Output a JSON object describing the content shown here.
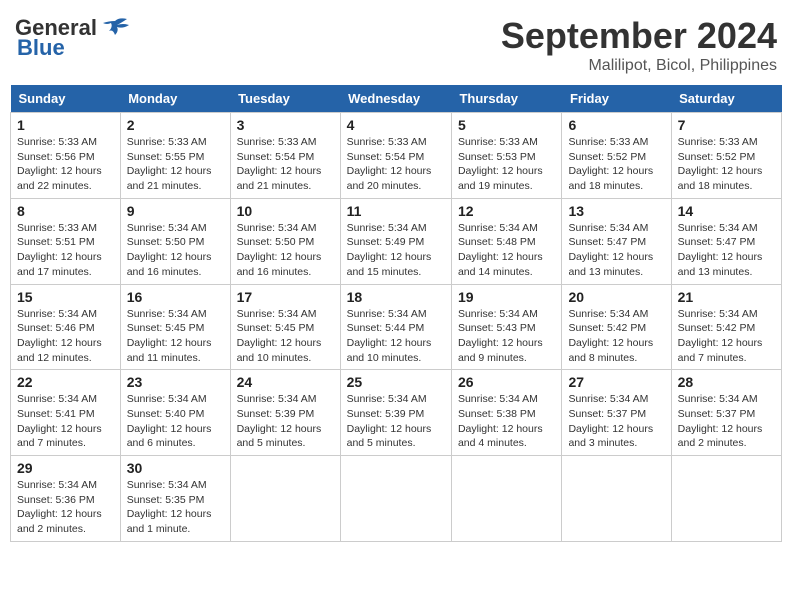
{
  "header": {
    "logo_line1": "General",
    "logo_line2": "Blue",
    "month": "September 2024",
    "location": "Malilipot, Bicol, Philippines"
  },
  "weekdays": [
    "Sunday",
    "Monday",
    "Tuesday",
    "Wednesday",
    "Thursday",
    "Friday",
    "Saturday"
  ],
  "weeks": [
    [
      {
        "day": "1",
        "sunrise": "5:33 AM",
        "sunset": "5:56 PM",
        "daylight": "12 hours and 22 minutes."
      },
      {
        "day": "2",
        "sunrise": "5:33 AM",
        "sunset": "5:55 PM",
        "daylight": "12 hours and 21 minutes."
      },
      {
        "day": "3",
        "sunrise": "5:33 AM",
        "sunset": "5:54 PM",
        "daylight": "12 hours and 21 minutes."
      },
      {
        "day": "4",
        "sunrise": "5:33 AM",
        "sunset": "5:54 PM",
        "daylight": "12 hours and 20 minutes."
      },
      {
        "day": "5",
        "sunrise": "5:33 AM",
        "sunset": "5:53 PM",
        "daylight": "12 hours and 19 minutes."
      },
      {
        "day": "6",
        "sunrise": "5:33 AM",
        "sunset": "5:52 PM",
        "daylight": "12 hours and 18 minutes."
      },
      {
        "day": "7",
        "sunrise": "5:33 AM",
        "sunset": "5:52 PM",
        "daylight": "12 hours and 18 minutes."
      }
    ],
    [
      {
        "day": "8",
        "sunrise": "5:33 AM",
        "sunset": "5:51 PM",
        "daylight": "12 hours and 17 minutes."
      },
      {
        "day": "9",
        "sunrise": "5:34 AM",
        "sunset": "5:50 PM",
        "daylight": "12 hours and 16 minutes."
      },
      {
        "day": "10",
        "sunrise": "5:34 AM",
        "sunset": "5:50 PM",
        "daylight": "12 hours and 16 minutes."
      },
      {
        "day": "11",
        "sunrise": "5:34 AM",
        "sunset": "5:49 PM",
        "daylight": "12 hours and 15 minutes."
      },
      {
        "day": "12",
        "sunrise": "5:34 AM",
        "sunset": "5:48 PM",
        "daylight": "12 hours and 14 minutes."
      },
      {
        "day": "13",
        "sunrise": "5:34 AM",
        "sunset": "5:47 PM",
        "daylight": "12 hours and 13 minutes."
      },
      {
        "day": "14",
        "sunrise": "5:34 AM",
        "sunset": "5:47 PM",
        "daylight": "12 hours and 13 minutes."
      }
    ],
    [
      {
        "day": "15",
        "sunrise": "5:34 AM",
        "sunset": "5:46 PM",
        "daylight": "12 hours and 12 minutes."
      },
      {
        "day": "16",
        "sunrise": "5:34 AM",
        "sunset": "5:45 PM",
        "daylight": "12 hours and 11 minutes."
      },
      {
        "day": "17",
        "sunrise": "5:34 AM",
        "sunset": "5:45 PM",
        "daylight": "12 hours and 10 minutes."
      },
      {
        "day": "18",
        "sunrise": "5:34 AM",
        "sunset": "5:44 PM",
        "daylight": "12 hours and 10 minutes."
      },
      {
        "day": "19",
        "sunrise": "5:34 AM",
        "sunset": "5:43 PM",
        "daylight": "12 hours and 9 minutes."
      },
      {
        "day": "20",
        "sunrise": "5:34 AM",
        "sunset": "5:42 PM",
        "daylight": "12 hours and 8 minutes."
      },
      {
        "day": "21",
        "sunrise": "5:34 AM",
        "sunset": "5:42 PM",
        "daylight": "12 hours and 7 minutes."
      }
    ],
    [
      {
        "day": "22",
        "sunrise": "5:34 AM",
        "sunset": "5:41 PM",
        "daylight": "12 hours and 7 minutes."
      },
      {
        "day": "23",
        "sunrise": "5:34 AM",
        "sunset": "5:40 PM",
        "daylight": "12 hours and 6 minutes."
      },
      {
        "day": "24",
        "sunrise": "5:34 AM",
        "sunset": "5:39 PM",
        "daylight": "12 hours and 5 minutes."
      },
      {
        "day": "25",
        "sunrise": "5:34 AM",
        "sunset": "5:39 PM",
        "daylight": "12 hours and 5 minutes."
      },
      {
        "day": "26",
        "sunrise": "5:34 AM",
        "sunset": "5:38 PM",
        "daylight": "12 hours and 4 minutes."
      },
      {
        "day": "27",
        "sunrise": "5:34 AM",
        "sunset": "5:37 PM",
        "daylight": "12 hours and 3 minutes."
      },
      {
        "day": "28",
        "sunrise": "5:34 AM",
        "sunset": "5:37 PM",
        "daylight": "12 hours and 2 minutes."
      }
    ],
    [
      {
        "day": "29",
        "sunrise": "5:34 AM",
        "sunset": "5:36 PM",
        "daylight": "12 hours and 2 minutes."
      },
      {
        "day": "30",
        "sunrise": "5:34 AM",
        "sunset": "5:35 PM",
        "daylight": "12 hours and 1 minute."
      },
      null,
      null,
      null,
      null,
      null
    ]
  ]
}
